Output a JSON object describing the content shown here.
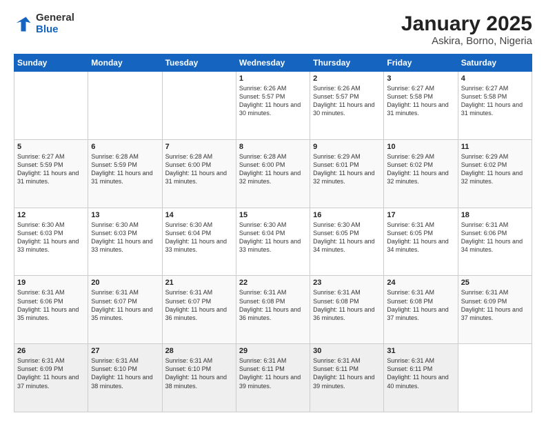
{
  "logo": {
    "general": "General",
    "blue": "Blue"
  },
  "header": {
    "month_year": "January 2025",
    "location": "Askira, Borno, Nigeria"
  },
  "weekdays": [
    "Sunday",
    "Monday",
    "Tuesday",
    "Wednesday",
    "Thursday",
    "Friday",
    "Saturday"
  ],
  "weeks": [
    [
      {
        "day": "",
        "sunrise": "",
        "sunset": "",
        "daylight": ""
      },
      {
        "day": "",
        "sunrise": "",
        "sunset": "",
        "daylight": ""
      },
      {
        "day": "",
        "sunrise": "",
        "sunset": "",
        "daylight": ""
      },
      {
        "day": "1",
        "sunrise": "Sunrise: 6:26 AM",
        "sunset": "Sunset: 5:57 PM",
        "daylight": "Daylight: 11 hours and 30 minutes."
      },
      {
        "day": "2",
        "sunrise": "Sunrise: 6:26 AM",
        "sunset": "Sunset: 5:57 PM",
        "daylight": "Daylight: 11 hours and 30 minutes."
      },
      {
        "day": "3",
        "sunrise": "Sunrise: 6:27 AM",
        "sunset": "Sunset: 5:58 PM",
        "daylight": "Daylight: 11 hours and 31 minutes."
      },
      {
        "day": "4",
        "sunrise": "Sunrise: 6:27 AM",
        "sunset": "Sunset: 5:58 PM",
        "daylight": "Daylight: 11 hours and 31 minutes."
      }
    ],
    [
      {
        "day": "5",
        "sunrise": "Sunrise: 6:27 AM",
        "sunset": "Sunset: 5:59 PM",
        "daylight": "Daylight: 11 hours and 31 minutes."
      },
      {
        "day": "6",
        "sunrise": "Sunrise: 6:28 AM",
        "sunset": "Sunset: 5:59 PM",
        "daylight": "Daylight: 11 hours and 31 minutes."
      },
      {
        "day": "7",
        "sunrise": "Sunrise: 6:28 AM",
        "sunset": "Sunset: 6:00 PM",
        "daylight": "Daylight: 11 hours and 31 minutes."
      },
      {
        "day": "8",
        "sunrise": "Sunrise: 6:28 AM",
        "sunset": "Sunset: 6:00 PM",
        "daylight": "Daylight: 11 hours and 32 minutes."
      },
      {
        "day": "9",
        "sunrise": "Sunrise: 6:29 AM",
        "sunset": "Sunset: 6:01 PM",
        "daylight": "Daylight: 11 hours and 32 minutes."
      },
      {
        "day": "10",
        "sunrise": "Sunrise: 6:29 AM",
        "sunset": "Sunset: 6:02 PM",
        "daylight": "Daylight: 11 hours and 32 minutes."
      },
      {
        "day": "11",
        "sunrise": "Sunrise: 6:29 AM",
        "sunset": "Sunset: 6:02 PM",
        "daylight": "Daylight: 11 hours and 32 minutes."
      }
    ],
    [
      {
        "day": "12",
        "sunrise": "Sunrise: 6:30 AM",
        "sunset": "Sunset: 6:03 PM",
        "daylight": "Daylight: 11 hours and 33 minutes."
      },
      {
        "day": "13",
        "sunrise": "Sunrise: 6:30 AM",
        "sunset": "Sunset: 6:03 PM",
        "daylight": "Daylight: 11 hours and 33 minutes."
      },
      {
        "day": "14",
        "sunrise": "Sunrise: 6:30 AM",
        "sunset": "Sunset: 6:04 PM",
        "daylight": "Daylight: 11 hours and 33 minutes."
      },
      {
        "day": "15",
        "sunrise": "Sunrise: 6:30 AM",
        "sunset": "Sunset: 6:04 PM",
        "daylight": "Daylight: 11 hours and 33 minutes."
      },
      {
        "day": "16",
        "sunrise": "Sunrise: 6:30 AM",
        "sunset": "Sunset: 6:05 PM",
        "daylight": "Daylight: 11 hours and 34 minutes."
      },
      {
        "day": "17",
        "sunrise": "Sunrise: 6:31 AM",
        "sunset": "Sunset: 6:05 PM",
        "daylight": "Daylight: 11 hours and 34 minutes."
      },
      {
        "day": "18",
        "sunrise": "Sunrise: 6:31 AM",
        "sunset": "Sunset: 6:06 PM",
        "daylight": "Daylight: 11 hours and 34 minutes."
      }
    ],
    [
      {
        "day": "19",
        "sunrise": "Sunrise: 6:31 AM",
        "sunset": "Sunset: 6:06 PM",
        "daylight": "Daylight: 11 hours and 35 minutes."
      },
      {
        "day": "20",
        "sunrise": "Sunrise: 6:31 AM",
        "sunset": "Sunset: 6:07 PM",
        "daylight": "Daylight: 11 hours and 35 minutes."
      },
      {
        "day": "21",
        "sunrise": "Sunrise: 6:31 AM",
        "sunset": "Sunset: 6:07 PM",
        "daylight": "Daylight: 11 hours and 36 minutes."
      },
      {
        "day": "22",
        "sunrise": "Sunrise: 6:31 AM",
        "sunset": "Sunset: 6:08 PM",
        "daylight": "Daylight: 11 hours and 36 minutes."
      },
      {
        "day": "23",
        "sunrise": "Sunrise: 6:31 AM",
        "sunset": "Sunset: 6:08 PM",
        "daylight": "Daylight: 11 hours and 36 minutes."
      },
      {
        "day": "24",
        "sunrise": "Sunrise: 6:31 AM",
        "sunset": "Sunset: 6:08 PM",
        "daylight": "Daylight: 11 hours and 37 minutes."
      },
      {
        "day": "25",
        "sunrise": "Sunrise: 6:31 AM",
        "sunset": "Sunset: 6:09 PM",
        "daylight": "Daylight: 11 hours and 37 minutes."
      }
    ],
    [
      {
        "day": "26",
        "sunrise": "Sunrise: 6:31 AM",
        "sunset": "Sunset: 6:09 PM",
        "daylight": "Daylight: 11 hours and 37 minutes."
      },
      {
        "day": "27",
        "sunrise": "Sunrise: 6:31 AM",
        "sunset": "Sunset: 6:10 PM",
        "daylight": "Daylight: 11 hours and 38 minutes."
      },
      {
        "day": "28",
        "sunrise": "Sunrise: 6:31 AM",
        "sunset": "Sunset: 6:10 PM",
        "daylight": "Daylight: 11 hours and 38 minutes."
      },
      {
        "day": "29",
        "sunrise": "Sunrise: 6:31 AM",
        "sunset": "Sunset: 6:11 PM",
        "daylight": "Daylight: 11 hours and 39 minutes."
      },
      {
        "day": "30",
        "sunrise": "Sunrise: 6:31 AM",
        "sunset": "Sunset: 6:11 PM",
        "daylight": "Daylight: 11 hours and 39 minutes."
      },
      {
        "day": "31",
        "sunrise": "Sunrise: 6:31 AM",
        "sunset": "Sunset: 6:11 PM",
        "daylight": "Daylight: 11 hours and 40 minutes."
      },
      {
        "day": "",
        "sunrise": "",
        "sunset": "",
        "daylight": ""
      }
    ]
  ]
}
